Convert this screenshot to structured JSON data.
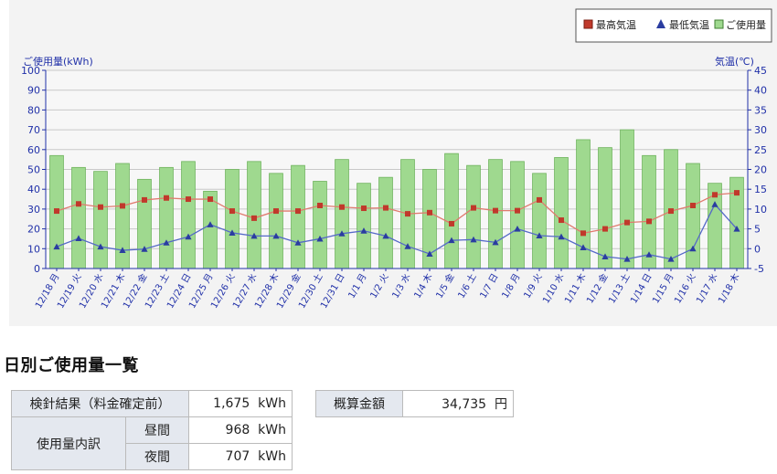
{
  "chart_data": {
    "type": "bar+line",
    "legend": [
      {
        "label": "最高気温",
        "color": "#c0392b",
        "marker": "square"
      },
      {
        "label": "最低気温",
        "color": "#2a3da0",
        "marker": "triangle"
      },
      {
        "label": "ご使用量",
        "color": "#9fd98f",
        "marker": "square"
      }
    ],
    "legend_position": "top-right",
    "y_left_label": "ご使用量(kWh)",
    "y_right_label": "気温(℃)",
    "y_left_range": [
      0,
      100
    ],
    "y_left_ticks": [
      "0",
      "10",
      "20",
      "30",
      "40",
      "50",
      "60",
      "70",
      "80",
      "90",
      "100"
    ],
    "y_right_range": [
      -5,
      45
    ],
    "y_right_ticks": [
      "-5",
      "0",
      "5",
      "10",
      "15",
      "20",
      "25",
      "30",
      "35",
      "40",
      "45"
    ],
    "grid": true,
    "categories": [
      "12/18 月",
      "12/19 火",
      "12/20 水",
      "12/21 木",
      "12/22 金",
      "12/23 土",
      "12/24 日",
      "12/25 月",
      "12/26 火",
      "12/27 水",
      "12/28 木",
      "12/29 金",
      "12/30 土",
      "12/31 日",
      "1/1 月",
      "1/2 火",
      "1/3 水",
      "1/4 木",
      "1/5 金",
      "1/6 土",
      "1/7 日",
      "1/8 月",
      "1/9 火",
      "1/10 水",
      "1/11 木",
      "1/12 金",
      "1/13 土",
      "1/14 日",
      "1/15 月",
      "1/16 火",
      "1/17 水",
      "1/18 木"
    ],
    "series": [
      {
        "name": "ご使用量",
        "axis": "left",
        "type": "bar",
        "color": "#9fd98f",
        "values": [
          57,
          51,
          49,
          53,
          45,
          51,
          54,
          39,
          50,
          54,
          48,
          52,
          44,
          55,
          43,
          46,
          55,
          50,
          58,
          52,
          55,
          54,
          48,
          56,
          65,
          61,
          70,
          57,
          60,
          53,
          43,
          46
        ]
      },
      {
        "name": "最高気温",
        "axis": "right",
        "type": "line",
        "color": "#c0392b",
        "values": [
          9.5,
          11.3,
          10.5,
          10.8,
          12.3,
          12.8,
          12.5,
          12.5,
          9.5,
          7.7,
          9.5,
          9.5,
          10.9,
          10.5,
          10.2,
          10.3,
          8.8,
          9.1,
          6.3,
          10.3,
          9.6,
          9.6,
          12.3,
          7.2,
          3.9,
          5.0,
          6.6,
          6.9,
          9.5,
          10.9,
          13.6,
          14.1
        ]
      },
      {
        "name": "最低気温",
        "axis": "right",
        "type": "line",
        "color": "#2a3da0",
        "values": [
          0.5,
          2.6,
          0.5,
          -0.4,
          -0.1,
          1.5,
          3.0,
          6.1,
          4.0,
          3.2,
          3.2,
          1.5,
          2.5,
          3.8,
          4.5,
          3.2,
          0.6,
          -1.3,
          2.1,
          2.3,
          1.6,
          5.0,
          3.3,
          3.0,
          0.3,
          -2.0,
          -2.6,
          -1.5,
          -2.6,
          0.0,
          11.2,
          5.0
        ]
      }
    ]
  },
  "section_title": "日別ご使用量一覧",
  "usage_table": {
    "meter_label": "検針結果（料金確定前）",
    "meter_value": "1,675",
    "unit": "kWh",
    "breakdown_label": "使用量内訳",
    "day_label": "昼間",
    "day_value": "968",
    "night_label": "夜間",
    "night_value": "707"
  },
  "estimate": {
    "label": "概算金額",
    "value": "34,735",
    "currency": "円"
  }
}
